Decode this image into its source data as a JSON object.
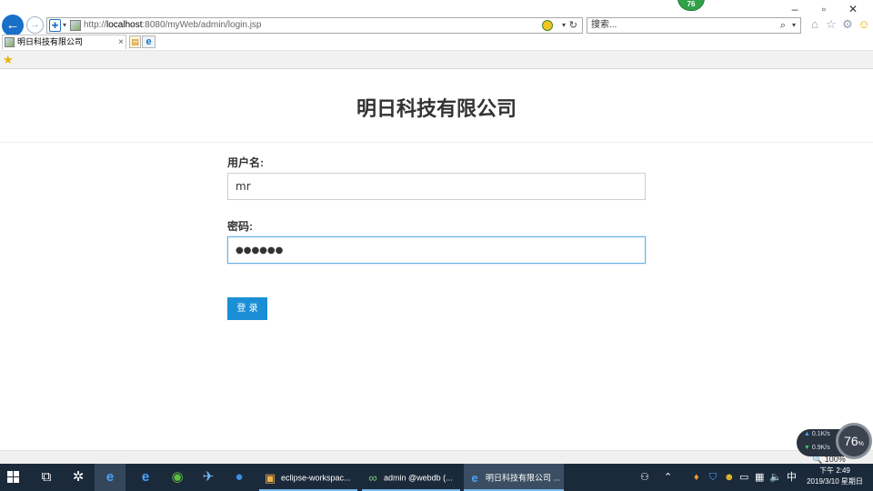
{
  "window": {
    "minimize": "–",
    "restore": "▫",
    "close": "✕"
  },
  "nav": {
    "back_glyph": "←",
    "forward_glyph": "→"
  },
  "address_bar": {
    "url_prefix": "http://",
    "url_host": "localhost",
    "url_rest": ":8080/myWeb/admin/login.jsp"
  },
  "search_bar": {
    "placeholder": "搜索..."
  },
  "badge": {
    "text": "76"
  },
  "tab": {
    "label": "明日科技有限公司",
    "close": "×"
  },
  "page": {
    "title": "明日科技有限公司",
    "username_label": "用户名:",
    "username_value": "mr",
    "password_label": "密码:",
    "password_masked": "●●●●●●",
    "login_button": "登 录"
  },
  "status": {
    "zoom": "🔍 100%"
  },
  "network_widget": {
    "upload": "0.1K/s",
    "download": "0.9K/s",
    "percent": "76",
    "percent_unit": "%"
  },
  "taskbar": {
    "tasks": [
      {
        "label": "eclipse-workspac..."
      },
      {
        "label": "admin @webdb (..."
      },
      {
        "label": "明日科技有限公司 ..."
      }
    ],
    "tray_ime": "中",
    "clock_time": "下午 2:49",
    "clock_date": "2019/3/10 星期日"
  }
}
